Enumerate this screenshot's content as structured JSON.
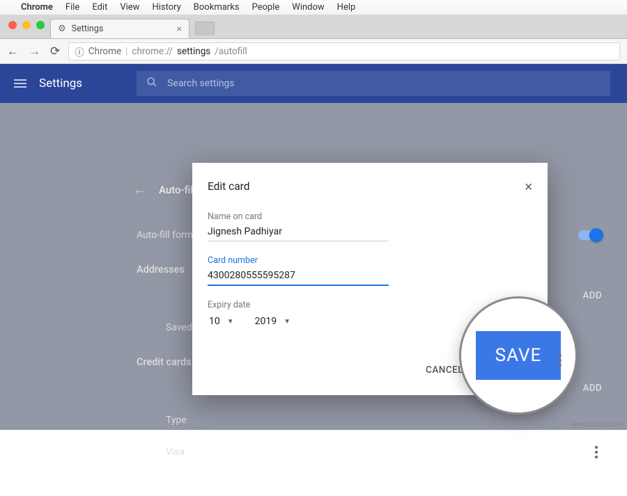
{
  "mac_menu": {
    "apple": "",
    "app": "Chrome",
    "items": [
      "File",
      "Edit",
      "View",
      "History",
      "Bookmarks",
      "People",
      "Window",
      "Help"
    ]
  },
  "tab": {
    "title": "Settings"
  },
  "toolbar": {
    "secure_label": "Chrome",
    "url_prefix": "chrome://",
    "url_bold": "settings",
    "url_rest": "/autofill"
  },
  "header": {
    "title": "Settings",
    "search_placeholder": "Search settings"
  },
  "page": {
    "section_title": "Auto-fill settings",
    "autofill_label": "Auto-fill forms",
    "addresses_label": "Addresses",
    "addresses_add": "ADD",
    "saved_address": "Saved address",
    "creditcards_label": "Credit cards",
    "creditcards_add": "ADD",
    "cc_type": "Type",
    "cc_visa": "Visa"
  },
  "modal": {
    "title": "Edit card",
    "name_label": "Name on card",
    "name_value": "Jignesh Padhiyar",
    "number_label": "Card number",
    "number_value": "4300280555595287",
    "expiry_label": "Expiry date",
    "expiry_month": "10",
    "expiry_year": "2019",
    "cancel": "CANCEL",
    "save": "SAVE"
  },
  "callout": {
    "save": "SAVE"
  },
  "watermark": "www.deuaq.com"
}
